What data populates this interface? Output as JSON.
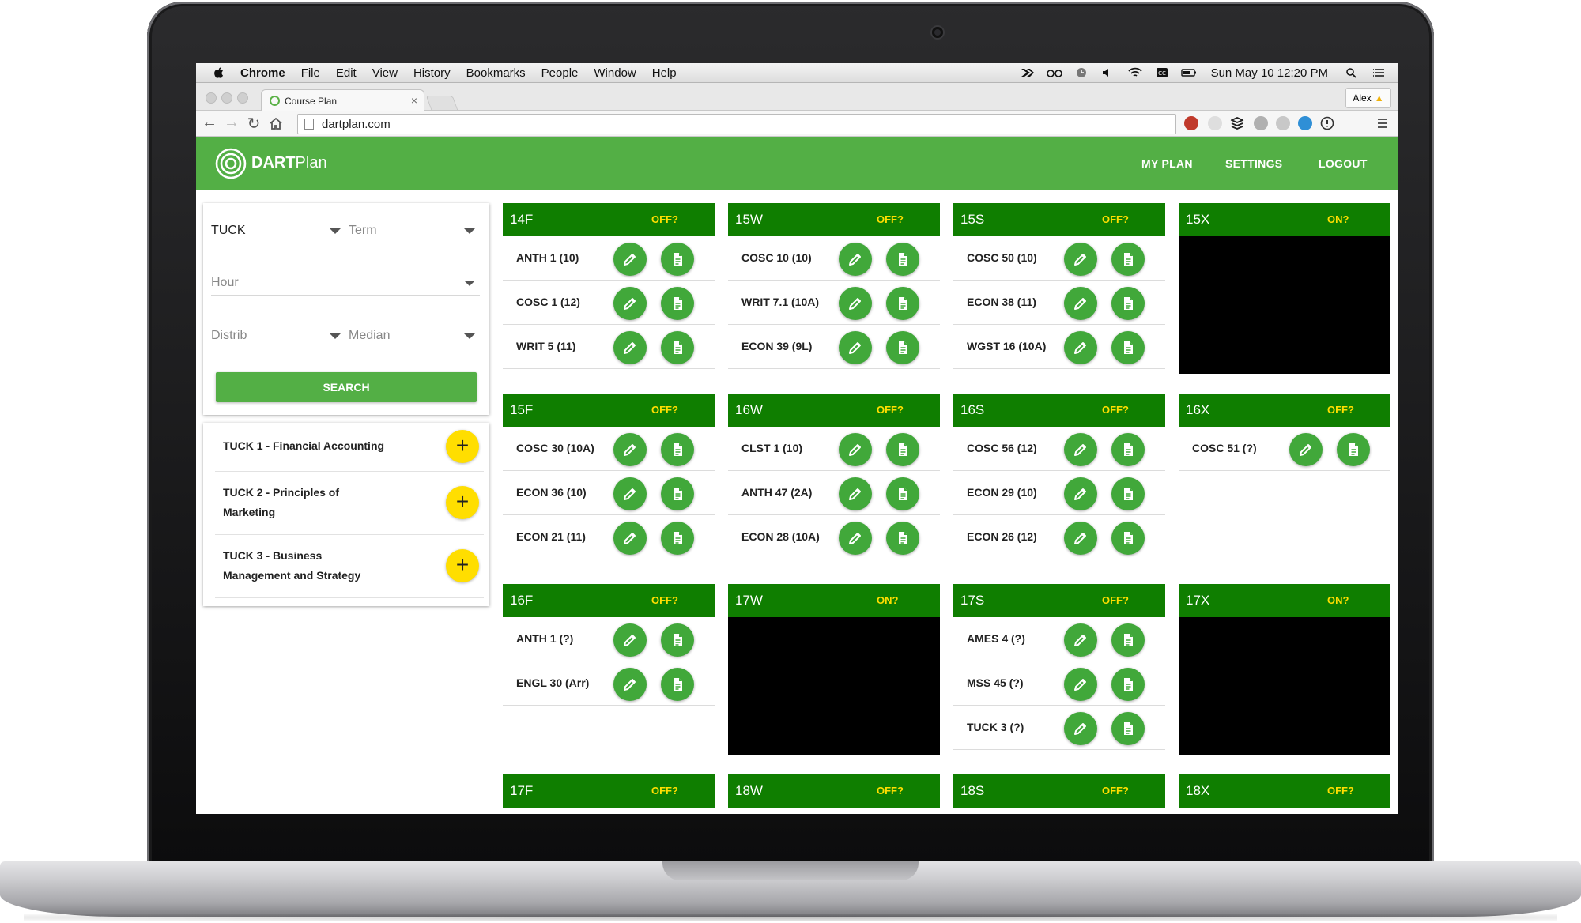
{
  "menubar": {
    "app": "Chrome",
    "items": [
      "File",
      "Edit",
      "View",
      "History",
      "Bookmarks",
      "People",
      "Window",
      "Help"
    ],
    "clock": "Sun May 10  12:20 PM"
  },
  "browser": {
    "tab_title": "Course Plan",
    "tab_close": "×",
    "profile": "Alex",
    "url": "dartplan.com"
  },
  "header": {
    "brand_bold": "DART",
    "brand_light": "Plan",
    "nav": [
      "MY PLAN",
      "SETTINGS",
      "LOGOUT"
    ]
  },
  "filters": {
    "school": "TUCK",
    "term_placeholder": "Term",
    "hour_placeholder": "Hour",
    "distrib_placeholder": "Distrib",
    "median_placeholder": "Median",
    "search_label": "SEARCH"
  },
  "results": [
    {
      "line1": "TUCK 1 - Financial Accounting",
      "line2": ""
    },
    {
      "line1": "TUCK 2 - Principles of",
      "line2": "Marketing"
    },
    {
      "line1": "TUCK 3 - Business",
      "line2": "Management and Strategy"
    }
  ],
  "terms": [
    {
      "name": "14F",
      "toggle": "OFF?",
      "off": false,
      "courses": [
        "ANTH 1 (10)",
        "COSC 1 (12)",
        "WRIT 5 (11)"
      ]
    },
    {
      "name": "15W",
      "toggle": "OFF?",
      "off": false,
      "courses": [
        "COSC 10 (10)",
        "WRIT 7.1 (10A)",
        "ECON 39 (9L)"
      ]
    },
    {
      "name": "15S",
      "toggle": "OFF?",
      "off": false,
      "courses": [
        "COSC 50 (10)",
        "ECON 38 (11)",
        "WGST 16 (10A)"
      ]
    },
    {
      "name": "15X",
      "toggle": "ON?",
      "off": true,
      "courses": []
    },
    {
      "name": "15F",
      "toggle": "OFF?",
      "off": false,
      "courses": [
        "COSC 30 (10A)",
        "ECON 36 (10)",
        "ECON 21 (11)"
      ]
    },
    {
      "name": "16W",
      "toggle": "OFF?",
      "off": false,
      "courses": [
        "CLST 1 (10)",
        "ANTH 47 (2A)",
        "ECON 28 (10A)"
      ]
    },
    {
      "name": "16S",
      "toggle": "OFF?",
      "off": false,
      "courses": [
        "COSC 56 (12)",
        "ECON 29 (10)",
        "ECON 26 (12)"
      ]
    },
    {
      "name": "16X",
      "toggle": "OFF?",
      "off": false,
      "courses": [
        "COSC 51 (?)"
      ]
    },
    {
      "name": "16F",
      "toggle": "OFF?",
      "off": false,
      "courses": [
        "ANTH 1 (?)",
        "ENGL 30 (Arr)"
      ]
    },
    {
      "name": "17W",
      "toggle": "ON?",
      "off": true,
      "courses": []
    },
    {
      "name": "17S",
      "toggle": "OFF?",
      "off": false,
      "courses": [
        "AMES 4 (?)",
        "MSS 45 (?)",
        "TUCK 3 (?)"
      ]
    },
    {
      "name": "17X",
      "toggle": "ON?",
      "off": true,
      "courses": []
    },
    {
      "name": "17F",
      "toggle": "OFF?",
      "off": false,
      "courses": []
    },
    {
      "name": "18W",
      "toggle": "OFF?",
      "off": false,
      "courses": []
    },
    {
      "name": "18S",
      "toggle": "OFF?",
      "off": false,
      "courses": []
    },
    {
      "name": "18X",
      "toggle": "OFF?",
      "off": false,
      "courses": []
    }
  ],
  "colors": {
    "brand_green": "#53af45",
    "term_header_green": "#0f7e00",
    "action_green": "#41a83a",
    "toggle_yellow": "#ffde00",
    "add_button_yellow": "#ffde00"
  },
  "icons": {
    "edit": "pencil-icon",
    "details": "document-icon",
    "add": "plus-icon"
  }
}
